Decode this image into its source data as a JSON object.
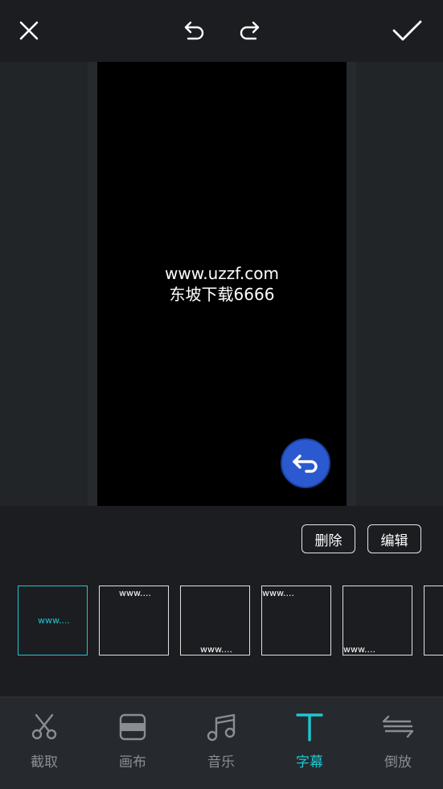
{
  "topbar": {
    "close_icon": "close-icon",
    "undo_icon": "undo-icon",
    "redo_icon": "redo-icon",
    "confirm_icon": "checkmark-icon"
  },
  "preview": {
    "subtitle_line1": "www.uzzf.com",
    "subtitle_line2": "东坡下载6666",
    "fab_icon": "return-arrow-icon"
  },
  "actions": {
    "delete_label": "删除",
    "edit_label": "编辑"
  },
  "thumbnails": [
    {
      "text": "www....",
      "selected": true
    },
    {
      "text": "www....",
      "selected": false
    },
    {
      "text": "www....",
      "selected": false
    },
    {
      "text": "www....",
      "selected": false
    },
    {
      "text": "www....",
      "selected": false
    }
  ],
  "tabs": [
    {
      "label": "截取",
      "icon": "scissors-icon",
      "active": false
    },
    {
      "label": "画布",
      "icon": "canvas-icon",
      "active": false
    },
    {
      "label": "音乐",
      "icon": "music-note-icon",
      "active": false
    },
    {
      "label": "字幕",
      "icon": "text-t-icon",
      "active": true
    },
    {
      "label": "倒放",
      "icon": "reverse-icon",
      "active": false
    }
  ],
  "colors": {
    "accent": "#1fc7d0",
    "fab": "#2b5ad0",
    "background": "#1b1d20"
  }
}
